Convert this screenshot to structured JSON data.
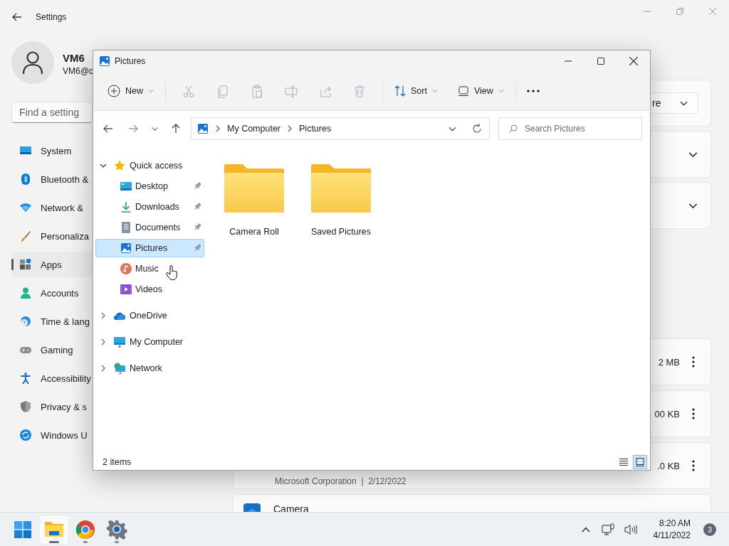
{
  "settings": {
    "title": "Settings",
    "user": {
      "name": "VM6",
      "email": "VM6@c"
    },
    "search": {
      "placeholder": "Find a setting"
    },
    "nav": [
      {
        "label": "System",
        "selected": false
      },
      {
        "label": "Bluetooth &",
        "selected": false
      },
      {
        "label": "Network &",
        "selected": false
      },
      {
        "label": "Personaliza",
        "selected": false
      },
      {
        "label": "Apps",
        "selected": true
      },
      {
        "label": "Accounts",
        "selected": false
      },
      {
        "label": "Time & lang",
        "selected": false
      },
      {
        "label": "Gaming",
        "selected": false
      },
      {
        "label": "Accessibility",
        "selected": false
      },
      {
        "label": "Privacy & s",
        "selected": false
      },
      {
        "label": "Windows U",
        "selected": false
      }
    ],
    "cards": [
      {
        "kind": "dropdown",
        "value": "re"
      },
      {
        "kind": "expander"
      },
      {
        "kind": "expander"
      }
    ],
    "apps": [
      {
        "size": "2 MB"
      },
      {
        "size": "00 KB"
      },
      {
        "size": ".0 KB",
        "details": "Microsoft Corporation  |  2/12/2022"
      },
      {
        "name": "Camera"
      }
    ]
  },
  "explorer": {
    "title": "Pictures",
    "toolbar": {
      "new": "New",
      "actions": [
        {
          "disabled": true
        },
        {
          "disabled": true
        },
        {
          "disabled": true
        },
        {
          "disabled": true
        },
        {
          "disabled": true
        },
        {
          "disabled": true
        }
      ],
      "sort": "Sort",
      "view": "View"
    },
    "address": {
      "crumbs": [
        "My Computer",
        "Pictures"
      ]
    },
    "search": {
      "placeholder": "Search Pictures"
    },
    "tree": [
      {
        "label": "Quick access",
        "expanded": true,
        "selected": false,
        "children": [
          {
            "label": "Desktop",
            "pinned": true,
            "selected": false
          },
          {
            "label": "Downloads",
            "pinned": true,
            "selected": false
          },
          {
            "label": "Documents",
            "pinned": true,
            "selected": false
          },
          {
            "label": "Pictures",
            "pinned": true,
            "selected": true
          },
          {
            "label": "Music",
            "pinned": false,
            "selected": false
          },
          {
            "label": "Videos",
            "pinned": false,
            "selected": false
          }
        ]
      },
      {
        "label": "OneDrive",
        "expanded": false,
        "selected": false
      },
      {
        "label": "My Computer",
        "expanded": false,
        "selected": false
      },
      {
        "label": "Network",
        "expanded": false,
        "selected": false
      }
    ],
    "items": [
      {
        "name": "Camera Roll"
      },
      {
        "name": "Saved Pictures"
      }
    ],
    "status": "2 items",
    "views": [
      {
        "selected": false
      },
      {
        "selected": true
      }
    ]
  },
  "taskbar": {
    "apps": [
      {
        "active": true
      },
      {
        "active": false
      },
      {
        "active": false
      }
    ],
    "time": "8:20 AM",
    "date": "4/11/2022",
    "badge": "3"
  }
}
